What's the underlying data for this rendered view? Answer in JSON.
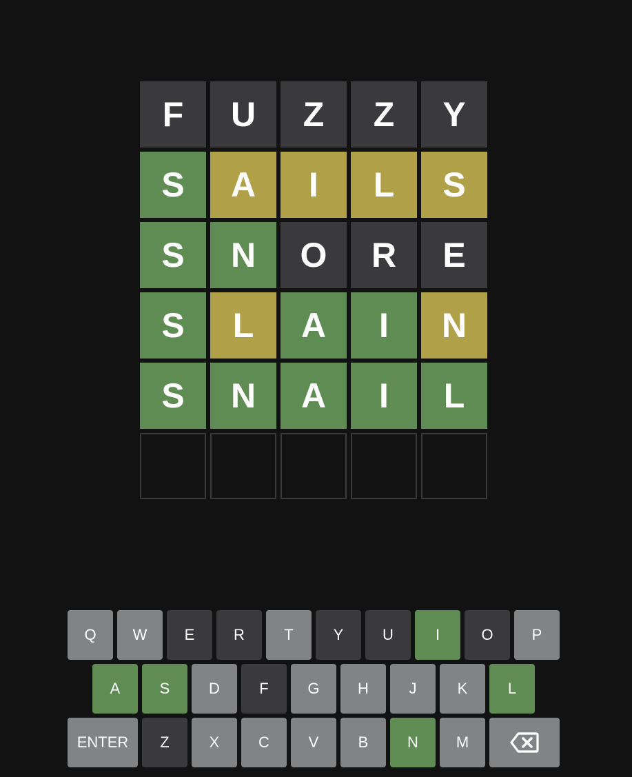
{
  "colors": {
    "background": "#121213",
    "absent": "#3a3a3c",
    "present": "#b0a048",
    "correct": "#5f8c53",
    "unused_key": "#818384",
    "text": "#ffffff"
  },
  "board": {
    "rows": [
      {
        "letters": [
          "F",
          "U",
          "Z",
          "Z",
          "Y"
        ],
        "states": [
          "absent",
          "absent",
          "absent",
          "absent",
          "absent"
        ]
      },
      {
        "letters": [
          "S",
          "A",
          "I",
          "L",
          "S"
        ],
        "states": [
          "correct",
          "present",
          "present",
          "present",
          "present"
        ]
      },
      {
        "letters": [
          "S",
          "N",
          "O",
          "R",
          "E"
        ],
        "states": [
          "correct",
          "correct",
          "absent",
          "absent",
          "absent"
        ]
      },
      {
        "letters": [
          "S",
          "L",
          "A",
          "I",
          "N"
        ],
        "states": [
          "correct",
          "present",
          "correct",
          "correct",
          "present"
        ]
      },
      {
        "letters": [
          "S",
          "N",
          "A",
          "I",
          "L"
        ],
        "states": [
          "correct",
          "correct",
          "correct",
          "correct",
          "correct"
        ]
      },
      {
        "letters": [
          "",
          "",
          "",
          "",
          ""
        ],
        "states": [
          "empty",
          "empty",
          "empty",
          "empty",
          "empty"
        ]
      }
    ]
  },
  "keyboard": {
    "rows": [
      [
        {
          "label": "Q",
          "state": "unused"
        },
        {
          "label": "W",
          "state": "unused"
        },
        {
          "label": "E",
          "state": "absent"
        },
        {
          "label": "R",
          "state": "absent"
        },
        {
          "label": "T",
          "state": "unused"
        },
        {
          "label": "Y",
          "state": "absent"
        },
        {
          "label": "U",
          "state": "absent"
        },
        {
          "label": "I",
          "state": "correct"
        },
        {
          "label": "O",
          "state": "absent"
        },
        {
          "label": "P",
          "state": "unused"
        }
      ],
      [
        {
          "label": "A",
          "state": "correct"
        },
        {
          "label": "S",
          "state": "correct"
        },
        {
          "label": "D",
          "state": "unused"
        },
        {
          "label": "F",
          "state": "absent"
        },
        {
          "label": "G",
          "state": "unused"
        },
        {
          "label": "H",
          "state": "unused"
        },
        {
          "label": "J",
          "state": "unused"
        },
        {
          "label": "K",
          "state": "unused"
        },
        {
          "label": "L",
          "state": "correct"
        }
      ],
      [
        {
          "label": "ENTER",
          "state": "unused",
          "wide": true
        },
        {
          "label": "Z",
          "state": "absent"
        },
        {
          "label": "X",
          "state": "unused"
        },
        {
          "label": "C",
          "state": "unused"
        },
        {
          "label": "V",
          "state": "unused"
        },
        {
          "label": "B",
          "state": "unused"
        },
        {
          "label": "N",
          "state": "correct"
        },
        {
          "label": "M",
          "state": "unused"
        },
        {
          "label": "",
          "icon": "backspace-icon",
          "state": "unused",
          "wide": true
        }
      ]
    ]
  }
}
